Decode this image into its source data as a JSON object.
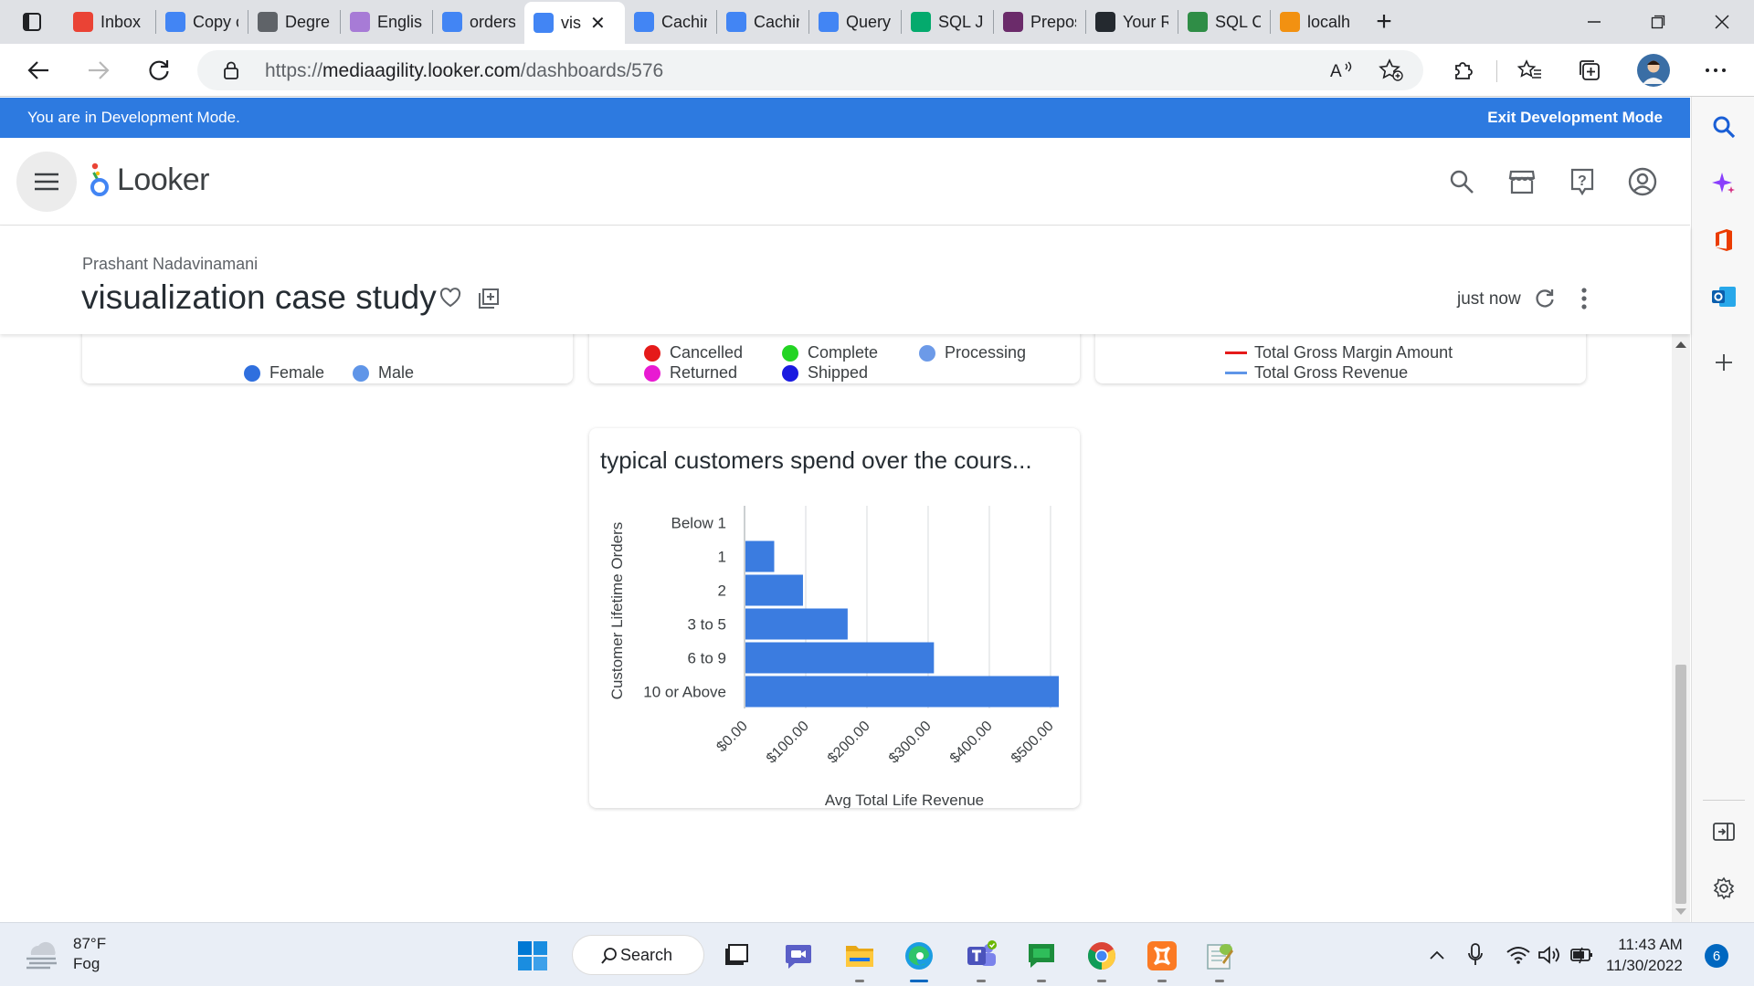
{
  "browser": {
    "tabs": [
      {
        "label": "Inbox",
        "icon": "gmail-icon",
        "color": "#ea4335"
      },
      {
        "label": "Copy c",
        "icon": "docs-icon",
        "color": "#4285f4"
      },
      {
        "label": "Degre",
        "icon": "glasses-icon",
        "color": "#5f6368"
      },
      {
        "label": "English",
        "icon": "u-icon",
        "color": "#a77bd6"
      },
      {
        "label": "orders",
        "icon": "looker-icon",
        "color": "#4285f4"
      },
      {
        "label": "vis",
        "icon": "looker-icon",
        "color": "#4285f4",
        "active": true
      },
      {
        "label": "Cachin",
        "icon": "cloud-icon",
        "color": "#4285f4"
      },
      {
        "label": "Cachin",
        "icon": "cloud-icon",
        "color": "#4285f4"
      },
      {
        "label": "Query",
        "icon": "bigquery-icon",
        "color": "#4285f4"
      },
      {
        "label": "SQL Jo",
        "icon": "w3schools-icon",
        "color": "#04aa6d"
      },
      {
        "label": "Prepos",
        "icon": "b-icon",
        "color": "#6b2b6a"
      },
      {
        "label": "Your R",
        "icon": "github-icon",
        "color": "#24292f"
      },
      {
        "label": "SQL C",
        "icon": "geeks-icon",
        "color": "#2f8d46"
      },
      {
        "label": "localh",
        "icon": "phpmyadmin-icon",
        "color": "#f29111"
      }
    ],
    "url_prefix": "https://",
    "url_host": "mediaagility.looker.com",
    "url_path": "/dashboards/576"
  },
  "devmode": {
    "message": "You are in Development Mode.",
    "exit_label": "Exit Development Mode"
  },
  "looker": {
    "logo_text": "Looker"
  },
  "dashboard": {
    "owner": "Prashant Nadavinamani",
    "title": "visualization case study",
    "last_run": "just now"
  },
  "tiles": {
    "gender_legend": [
      {
        "label": "Female",
        "color": "#2f6fde"
      },
      {
        "label": "Male",
        "color": "#5f95e8"
      }
    ],
    "status_legend": [
      {
        "label": "Cancelled",
        "color": "#e51a1a"
      },
      {
        "label": "Complete",
        "color": "#23d423"
      },
      {
        "label": "Processing",
        "color": "#6c9ae8"
      },
      {
        "label": "Returned",
        "color": "#e81ad2"
      },
      {
        "label": "Shipped",
        "color": "#1a1ae0"
      }
    ],
    "revenue_legend": [
      {
        "label": "Total Gross Margin Amount",
        "color": "#e51a1a"
      },
      {
        "label": "Total Gross Revenue",
        "color": "#5f95e8"
      }
    ]
  },
  "chart_data": {
    "type": "bar",
    "orientation": "horizontal",
    "title": "typical customers spend over the cours...",
    "xlabel": "Avg Total Life Revenue",
    "ylabel": "Customer Lifetime Orders",
    "categories": [
      "Below 1",
      "1",
      "2",
      "3 to 5",
      "6 to 9",
      "10 or Above"
    ],
    "values": [
      0,
      47,
      94,
      167,
      308,
      512
    ],
    "xlim": [
      0,
      500
    ],
    "x_ticks": [
      "$0.00",
      "$100.00",
      "$200.00",
      "$300.00",
      "$400.00",
      "$500.00"
    ],
    "bar_color": "#3b7ce0",
    "grid": true
  },
  "taskbar": {
    "weather_temp": "87°F",
    "weather_cond": "Fog",
    "search_label": "Search",
    "time": "11:43 AM",
    "date": "11/30/2022",
    "notification_count": "6"
  }
}
